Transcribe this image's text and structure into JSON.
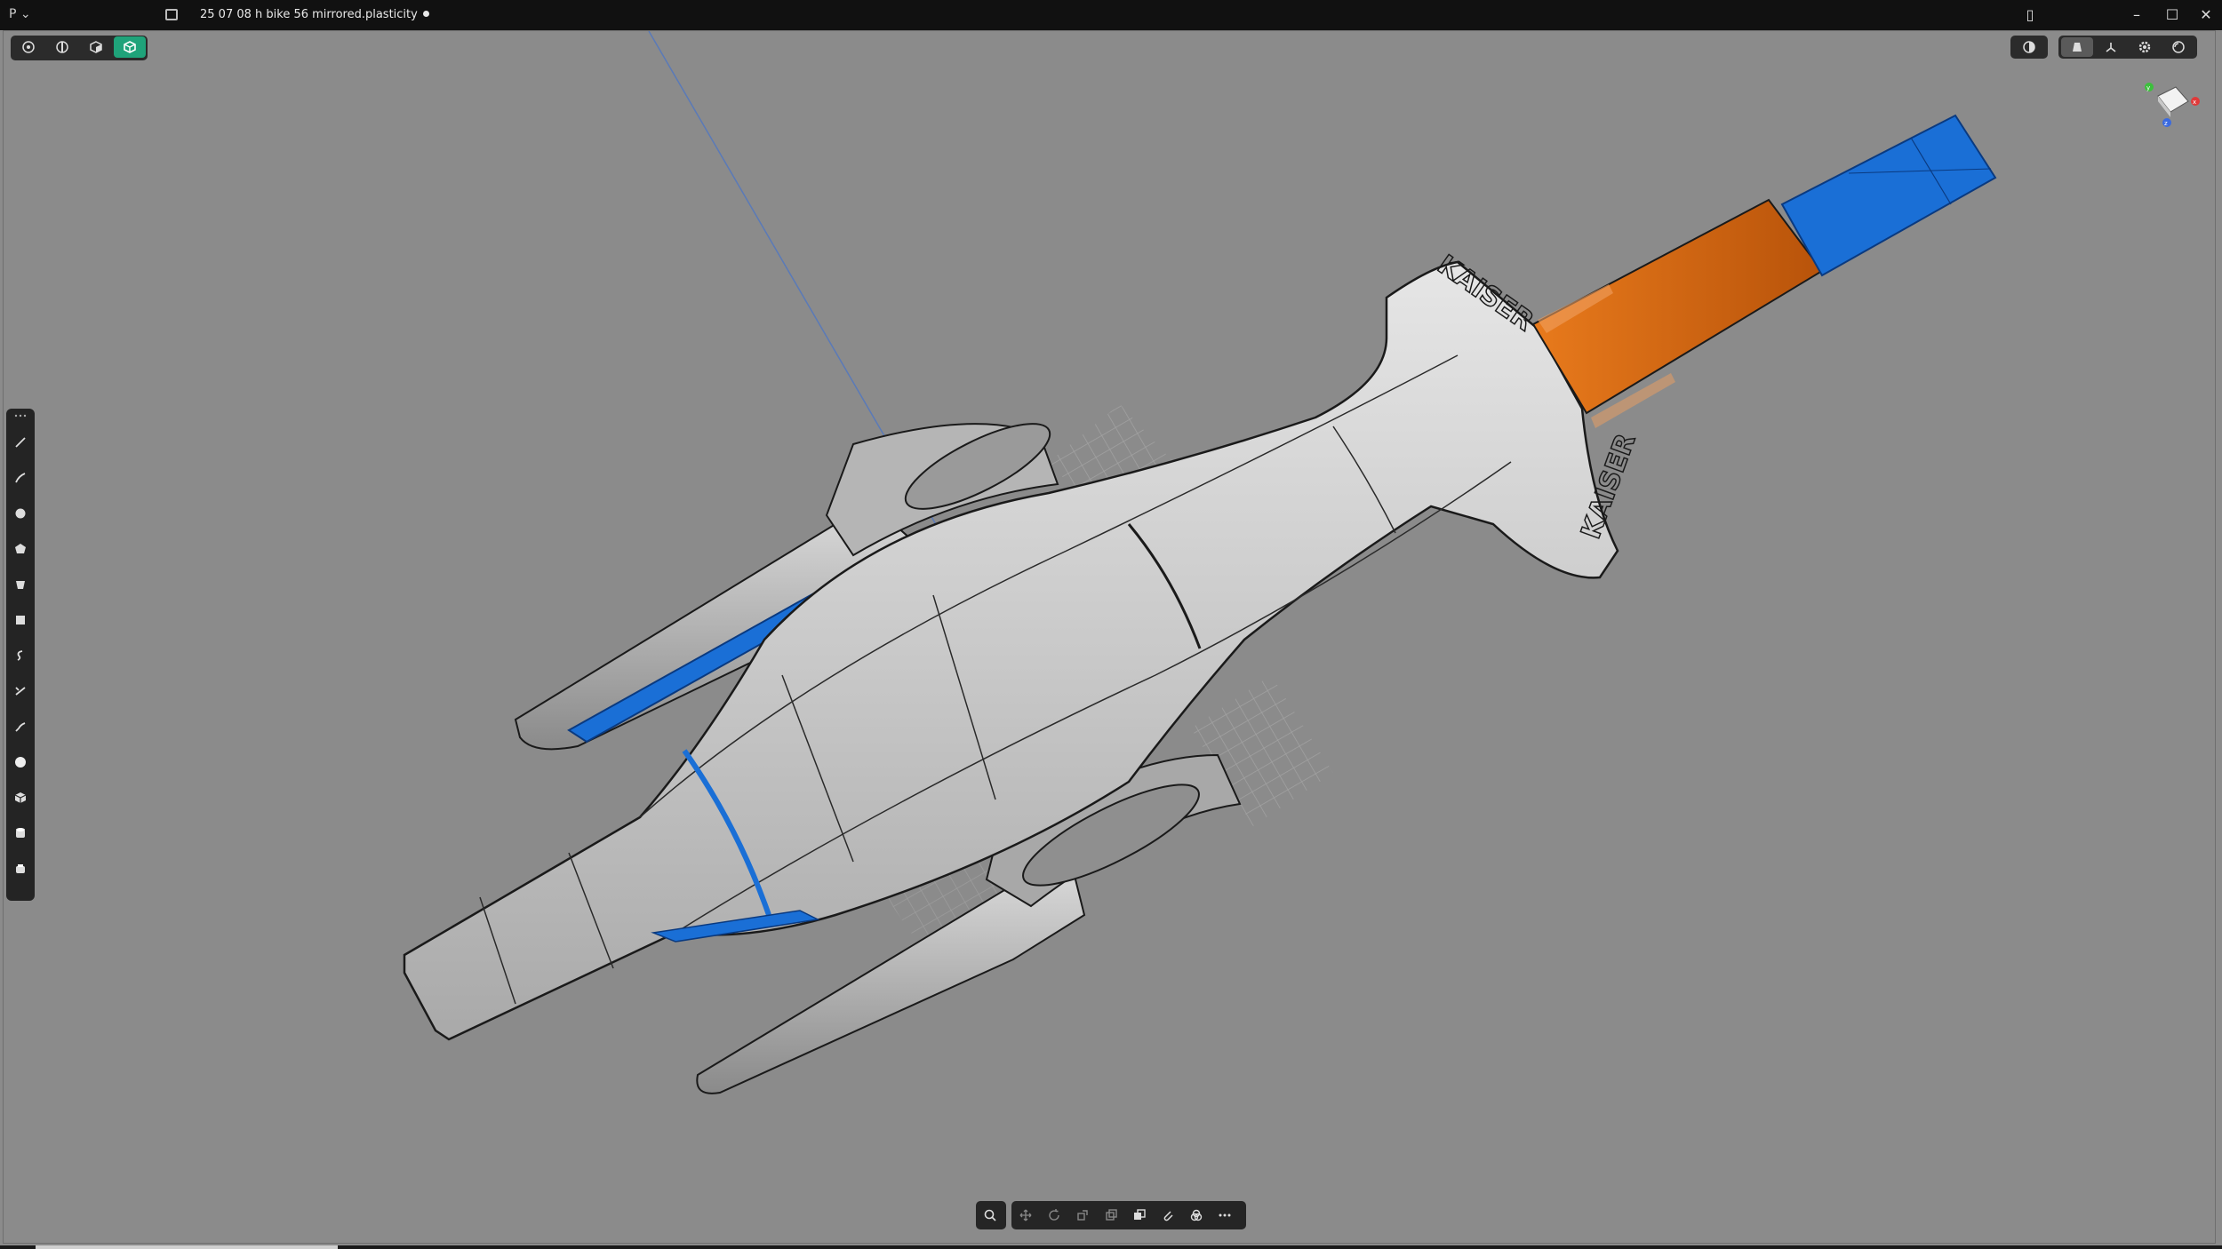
{
  "app": {
    "logo": "P",
    "title": "25 07 08 h bike 56 mirrored.plasticity"
  },
  "window_controls": [
    "minimize",
    "maximize",
    "close"
  ],
  "selection_modes": [
    {
      "name": "control-point",
      "icon": "vertex-icon",
      "active": false
    },
    {
      "name": "edge",
      "icon": "edge-icon",
      "active": false
    },
    {
      "name": "face",
      "icon": "face-icon",
      "active": false
    },
    {
      "name": "solid",
      "icon": "solid-icon",
      "active": true
    }
  ],
  "view_options": [
    {
      "icon": "xray-icon",
      "active": false
    },
    {
      "icon": "shaded-icon",
      "active": true
    },
    {
      "icon": "axis-icon",
      "active": false
    },
    {
      "icon": "settings-gear-icon",
      "active": false
    },
    {
      "icon": "render-sphere-icon",
      "active": false
    }
  ],
  "left_tools": [
    "line-tool-icon",
    "curve-tool-icon",
    "circle-tool-icon",
    "polygon-tool-icon",
    "extrude-tool-icon",
    "rectangle-tool-icon",
    "spiral-tool-icon",
    "trim-tool-icon",
    "fillet-curve-icon",
    "sphere-tool-icon",
    "box-tool-icon",
    "cylinder-tool-icon",
    "boolean-tool-icon"
  ],
  "bottom_tools": [
    "search-icon",
    "move-icon",
    "rotate-icon",
    "scale-icon",
    "duplicate-icon",
    "boolean-icon",
    "attach-icon",
    "group-icon",
    "more-icon"
  ],
  "gizmo": {
    "x_label": "x",
    "y_label": "y",
    "z_label": "z"
  },
  "colors": {
    "accent": "#1fa37a",
    "selected_blue": "#1a6fd6",
    "orange": "#d86a10",
    "background": "#8b8b8b"
  },
  "model_labels": {
    "logo_top": "KAISER",
    "logo_side": "KAISER"
  }
}
